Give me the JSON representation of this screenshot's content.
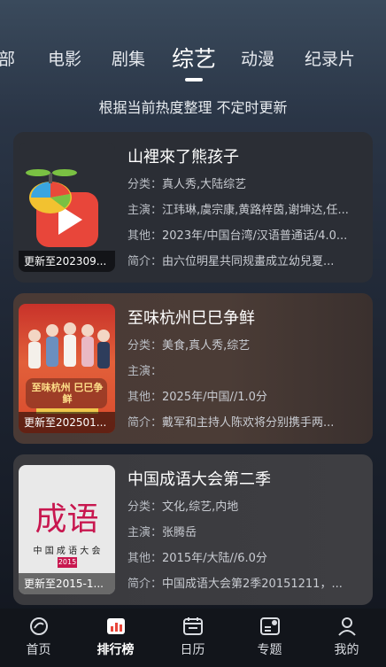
{
  "top_tabs": [
    {
      "label": "部"
    },
    {
      "label": "电影"
    },
    {
      "label": "剧集"
    },
    {
      "label": "综艺",
      "active": true
    },
    {
      "label": "动漫"
    },
    {
      "label": "纪录片"
    }
  ],
  "subtitle": "根据当前热度整理 不定时更新",
  "cards": [
    {
      "title": "山裡來了熊孩子",
      "badge": "更新至202309...",
      "category_key": "分类：",
      "category": "真人秀,大陆综艺",
      "cast_key": "主演：",
      "cast": "江玮琳,虞宗康,黄路梓茵,谢坤达,任...",
      "other_key": "其他：",
      "other": "2023年/中国台湾/汉语普通话/4.0...",
      "intro_key": "简介：",
      "intro": "由六位明星共同规畫成立幼兒夏..."
    },
    {
      "title": "至味杭州巳巳争鲜",
      "badge": "更新至202501...",
      "poster_text": "至味杭州 巳巳争鲜",
      "category_key": "分类：",
      "category": "美食,真人秀,综艺",
      "cast_key": "主演：",
      "cast": "",
      "other_key": "其他：",
      "other": "2025年/中国//1.0分",
      "intro_key": "简介：",
      "intro": "戴军和主持人陈欢将分别携手两..."
    },
    {
      "title": "中国成语大会第二季",
      "badge": "更新至2015-1...",
      "poster_logo": "成语",
      "poster_caption": "中 国 成 语 大 会",
      "poster_year": "2015",
      "category_key": "分类：",
      "category": "文化,综艺,内地",
      "cast_key": "主演：",
      "cast": "张腾岳",
      "other_key": "其他：",
      "other": "2015年/大陆//6.0分",
      "intro_key": "简介：",
      "intro": "中国成语大会第2季20151211，..."
    }
  ],
  "bottom_nav": [
    {
      "label": "首页",
      "icon": "home-icon"
    },
    {
      "label": "排行榜",
      "icon": "ranking-icon",
      "active": true
    },
    {
      "label": "日历",
      "icon": "calendar-icon"
    },
    {
      "label": "专题",
      "icon": "topic-icon"
    },
    {
      "label": "我的",
      "icon": "profile-icon"
    }
  ],
  "colors": {
    "logo_red": "#e8463a",
    "poster3_bg": "#e9e9e9",
    "poster3_logo": "#c8174f"
  }
}
